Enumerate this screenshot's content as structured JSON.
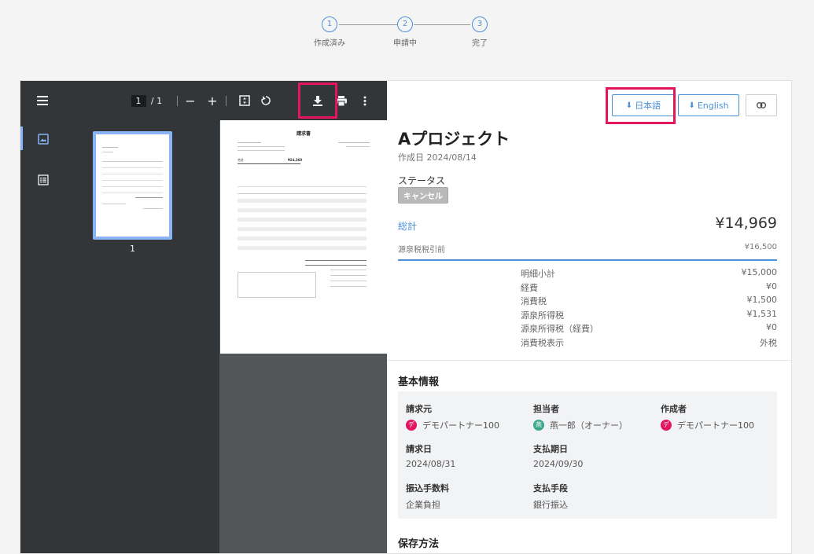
{
  "stepper": {
    "steps": [
      {
        "num": "1",
        "label": "作成済み"
      },
      {
        "num": "2",
        "label": "申請中"
      },
      {
        "num": "3",
        "label": "完了"
      }
    ]
  },
  "viewer": {
    "page_current": "1",
    "page_total": "/ 1",
    "thumbnail_label": "1",
    "doc_title": "請求書",
    "doc_amount_label": "合計",
    "doc_amount": "¥24,360"
  },
  "actions": {
    "download_ja": "日本語",
    "download_en": "English"
  },
  "project": {
    "title": "Aプロジェクト",
    "created": "作成日 2024/08/14",
    "status_label": "ステータス",
    "status_badge": "キャンセル",
    "total_label": "総計",
    "total_value": "¥14,969",
    "withholding_label": "源泉税税引前",
    "withholding_value": "¥16,500",
    "breakdown": [
      {
        "label": "明細小計",
        "value": "¥15,000"
      },
      {
        "label": "経費",
        "value": "¥0"
      },
      {
        "label": "消費税",
        "value": "¥1,500"
      },
      {
        "label": "源泉所得税",
        "value": "¥1,531"
      },
      {
        "label": "源泉所得税（経費）",
        "value": "¥0"
      },
      {
        "label": "消費税表示",
        "value": "外税"
      }
    ]
  },
  "basic_info": {
    "title": "基本情報",
    "requester_label": "請求元",
    "requester_value": "デモパートナー100",
    "assignee_label": "担当者",
    "assignee_value": "燕一郎（オーナー）",
    "creator_label": "作成者",
    "creator_value": "デモパートナー100",
    "invoice_date_label": "請求日",
    "invoice_date_value": "2024/08/31",
    "due_date_label": "支払期日",
    "due_date_value": "2024/09/30",
    "fee_label": "振込手数料",
    "fee_value": "企業負担",
    "method_label": "支払手段",
    "method_value": "銀行振込",
    "avatar_partner": "デ",
    "avatar_user": "燕"
  },
  "storage": {
    "title": "保存方法"
  },
  "colors": {
    "accent": "#4a90d9",
    "highlight": "#e2155d",
    "partner_avatar": "#e2155d",
    "user_avatar": "#3aa88a",
    "viewer_toolbar": "#323639",
    "viewer_background": "#525659"
  }
}
